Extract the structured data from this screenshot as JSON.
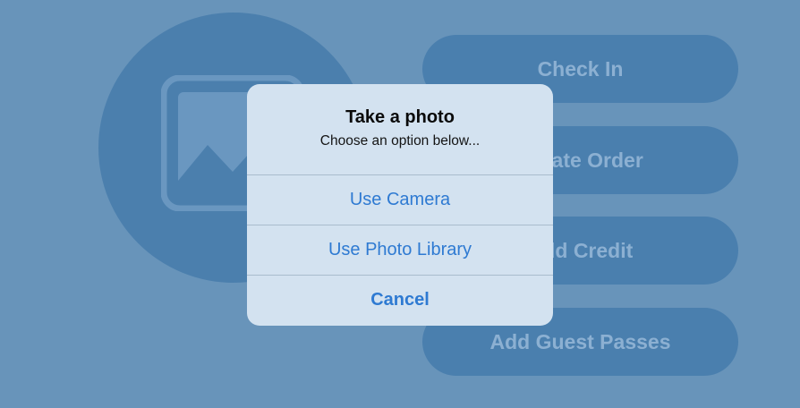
{
  "background": {
    "actions": [
      {
        "label": "Check In"
      },
      {
        "label": "Create Order"
      },
      {
        "label": "Add Credit"
      },
      {
        "label": "Add Guest Passes"
      }
    ],
    "avatar_icon": "photo-placeholder-icon"
  },
  "alert": {
    "title": "Take a photo",
    "message": "Choose an option below...",
    "actions": [
      {
        "label": "Use Camera"
      },
      {
        "label": "Use Photo Library"
      },
      {
        "label": "Cancel"
      }
    ]
  },
  "colors": {
    "background": "#6894ba",
    "button_fill": "#4a7fae",
    "alert_fill": "#d3e2f0",
    "action_text": "#2e7ad2"
  }
}
